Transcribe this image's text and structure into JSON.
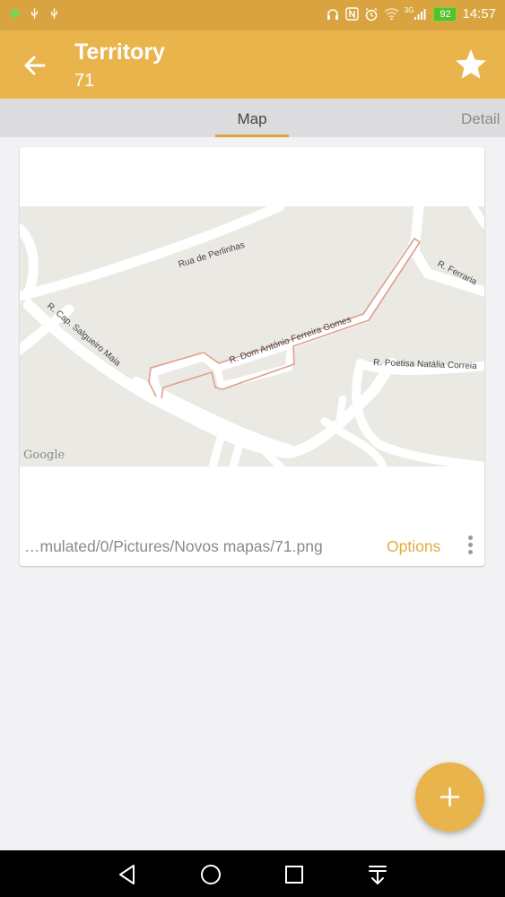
{
  "status_bar": {
    "battery": "92",
    "network": "3G",
    "time": "14:57"
  },
  "app_bar": {
    "title": "Territory",
    "subtitle": "71",
    "icons": {
      "back": "arrow-left",
      "favorite": "star"
    }
  },
  "tabs": [
    {
      "label": "Map",
      "selected": true
    },
    {
      "label": "Detail",
      "selected": false
    }
  ],
  "card": {
    "map": {
      "streets": [
        "Rua de Perlinhas",
        "R. Ferraria",
        "R. Cap. Salgueiro Maia",
        "R. Dom António Ferreira Gomes",
        "R. Poetisa Natália Correia"
      ],
      "attribution": "Google"
    },
    "file_path": "…mulated/0/Pictures/Novos mapas/71.png",
    "options_label": "Options"
  },
  "fab": {
    "icon": "plus"
  },
  "colors": {
    "primary": "#e9b44c",
    "status_bar": "#d9a43f",
    "accent_text": "#e0ad3e",
    "territory_outline": "#e0a08c"
  }
}
